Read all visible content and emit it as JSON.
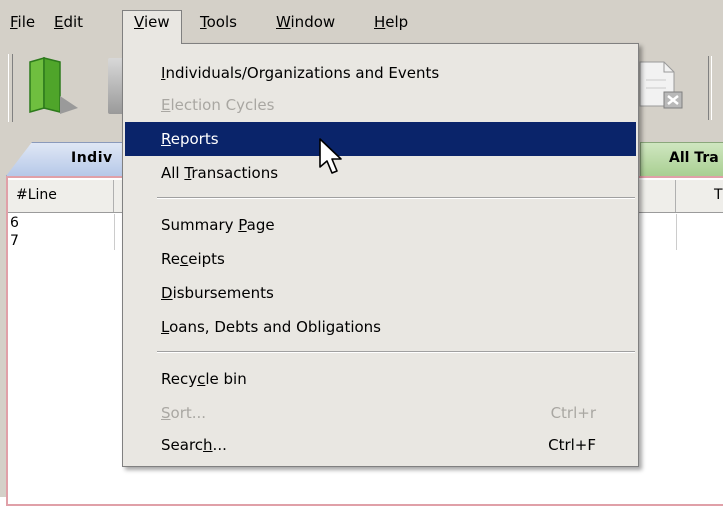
{
  "menubar": {
    "file": "File",
    "edit": "Edit",
    "view": "View",
    "tools": "Tools",
    "window": "Window",
    "help": "Help"
  },
  "tabs": {
    "left": "Indiv",
    "right": "All Tra"
  },
  "grid": {
    "headers": [
      "#Line",
      "T"
    ],
    "rows": [
      "6",
      "7"
    ]
  },
  "view_menu": {
    "items": [
      {
        "label": "Individuals/Organizations and Events",
        "accel": "I",
        "enabled": true
      },
      {
        "label": "Election Cycles",
        "accel": "E",
        "enabled": false
      },
      {
        "label": "Reports",
        "accel": "R",
        "enabled": true,
        "highlighted": true
      },
      {
        "label": "All Transactions",
        "accel": "T",
        "enabled": true
      },
      {
        "label": "Summary Page",
        "accel": "P",
        "enabled": true
      },
      {
        "label": "Receipts",
        "accel": "c",
        "enabled": true
      },
      {
        "label": "Disbursements",
        "accel": "D",
        "enabled": true
      },
      {
        "label": "Loans, Debts and Obligations",
        "accel": "L",
        "enabled": true
      },
      {
        "label": "Recycle bin",
        "accel": "y",
        "enabled": true
      },
      {
        "label": "Sort...",
        "accel": "S",
        "enabled": false,
        "shortcut": "Ctrl+r"
      },
      {
        "label": "Search...",
        "accel": "h",
        "enabled": true,
        "shortcut": "Ctrl+F"
      }
    ]
  },
  "colors": {
    "highlight": "#0a246a",
    "menu_bg": "#e9e7e2",
    "chrome_bg": "#d4d0c8",
    "disabled_text": "#a9a7a2"
  }
}
